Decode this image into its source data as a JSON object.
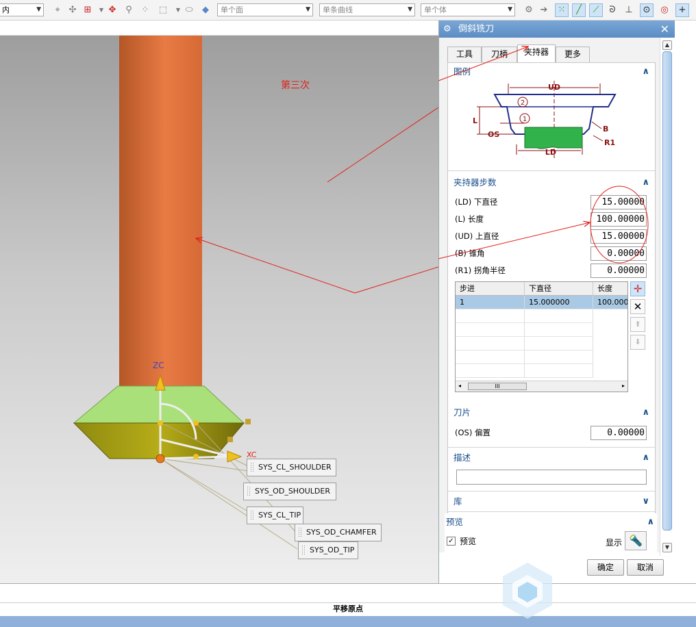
{
  "toolbar": {
    "first_combo": "内",
    "face_combo": "单个面",
    "curve_combo": "单条曲线",
    "body_combo": "单个体"
  },
  "viewport": {
    "annotation": "第三次",
    "axis_z": "ZC",
    "axis_x": "XC",
    "tags": [
      "SYS_CL_SHOULDER",
      "SYS_OD_SHOULDER",
      "SYS_CL_TIP",
      "SYS_OD_CHAMFER",
      "SYS_OD_TIP"
    ],
    "arrow_color": "#e0201a",
    "tool_shank_color": "#e6763e",
    "tool_head_color": "#a9e07a"
  },
  "dialog": {
    "title": "倒斜铣刀",
    "tabs": [
      "工具",
      "刀柄",
      "夹持器",
      "更多"
    ],
    "active_tab": "夹持器",
    "legend": {
      "title": "图例",
      "labels": {
        "ud": "UD",
        "ld": "LD",
        "l": "L",
        "os": "OS",
        "b": "B",
        "r1": "R1",
        "n1": "1",
        "n2": "2"
      }
    },
    "holder_steps": {
      "title": "夹持器步数",
      "fields": [
        {
          "label": "(LD) 下直径",
          "value": "15.00000"
        },
        {
          "label": "(L) 长度",
          "value": "100.00000"
        },
        {
          "label": "(UD) 上直径",
          "value": "15.00000"
        },
        {
          "label": "(B) 锥角",
          "value": "0.00000"
        },
        {
          "label": "(R1) 拐角半径",
          "value": "0.00000"
        }
      ],
      "table": {
        "headers": [
          "步进",
          "下直径",
          "长度"
        ],
        "rows": [
          [
            "1",
            "15.000000",
            "100.000"
          ]
        ]
      }
    },
    "insert": {
      "title": "刀片",
      "field_label": "(OS) 偏置",
      "field_value": "0.00000"
    },
    "description": {
      "title": "描述",
      "value": ""
    },
    "library": {
      "title": "库"
    },
    "preview": {
      "title": "预览",
      "checkbox_label": "预览",
      "checked": true,
      "show_label": "显示"
    },
    "ok_label": "确定",
    "cancel_label": "取消"
  },
  "status": {
    "prompt": "平移原点"
  }
}
